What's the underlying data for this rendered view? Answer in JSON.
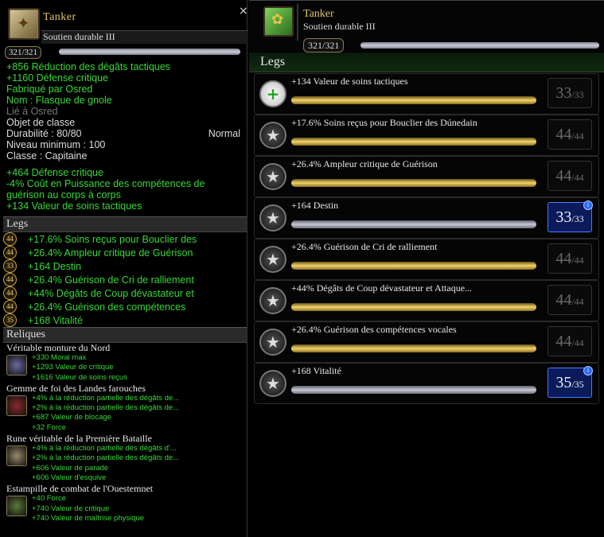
{
  "tooltip": {
    "title": "Tanker",
    "type": "Soutien durable III",
    "close_glyph": "×",
    "xp": "321/321",
    "lines": [
      {
        "text": "+856 Réduction des dégâts tactiques",
        "cls": "g"
      },
      {
        "text": "+1160 Défense critique",
        "cls": "g"
      },
      {
        "text": "Fabriqué par Osred",
        "cls": "g"
      },
      {
        "text": "Nom : Flasque de gnole",
        "cls": "g"
      },
      {
        "text": "Lié à Osred",
        "cls": "d"
      },
      {
        "text": "Objet de classe",
        "cls": "w"
      }
    ],
    "durability_label": "Durabilité : 80/80",
    "durability_quality": "Normal",
    "min_level": "Niveau minimum : 100",
    "class_line": "Classe : Capitaine",
    "extra_lines": [
      "+464 Défense critique",
      "-4% Coût en Puissance des compétences de",
      "guérison au corps à corps",
      "+134 Valeur de soins tactiques"
    ],
    "legs_title": "Legs",
    "legs": [
      {
        "lvl": "44",
        "text": "+17.6% Soins reçus pour Bouclier des"
      },
      {
        "lvl": "44",
        "text": "+26.4% Ampleur critique de Guérison"
      },
      {
        "lvl": "33",
        "text": "+164 Destin"
      },
      {
        "lvl": "44",
        "text": "+26.4% Guérison de Cri de ralliement"
      },
      {
        "lvl": "44",
        "text": "+44% Dégâts de Coup dévastateur et"
      },
      {
        "lvl": "44",
        "text": "+26.4% Guérison des compétences"
      },
      {
        "lvl": "35",
        "text": "+168 Vitalité"
      }
    ],
    "relics_title": "Reliques",
    "relics": [
      {
        "name": "Véritable monture du Nord",
        "icon_color": "#6a6aa0",
        "stats": [
          "+330 Moral max",
          "+1293 Valeur de critique",
          "+1616 Valeur de soins reçus"
        ]
      },
      {
        "name": "Gemme de foi des Landes farouches",
        "icon_color": "#8a2a2a",
        "stats": [
          "+4% à la réduction partielle des dégâts de...",
          "+2% à la réduction partielle des dégâts de...",
          "+687 Valeur de blocage",
          "+32 Force"
        ]
      },
      {
        "name": "Rune véritable de la Première Bataille",
        "icon_color": "#9a8a6a",
        "stats": [
          "+4% à la réduction partielle des dégâts d'...",
          "+2% à la réduction partielle des dégâts de...",
          "+606 Valeur de parade",
          "+606 Valeur d'esquive"
        ]
      },
      {
        "name": "Estampille de combat de l'Ouestemnet",
        "icon_color": "#5a7a3a",
        "stats": [
          "+40 Force",
          "+740 Valeur de critique",
          "+740 Valeur de maîtrise physique"
        ]
      }
    ]
  },
  "panel": {
    "title": "Tanker",
    "type": "Soutien durable III",
    "xp": "321/321",
    "legs_title": "Legs",
    "legs": [
      {
        "text": "+134 Valeur de soins tactiques",
        "lvl": "33",
        "max": "33",
        "icon": "plus",
        "bar": "gold",
        "active": false
      },
      {
        "text": "+17.6% Soins reçus pour Bouclier des Dúnedain",
        "lvl": "44",
        "max": "44",
        "icon": "star",
        "bar": "gold",
        "active": false
      },
      {
        "text": "+26.4% Ampleur critique de Guérison",
        "lvl": "44",
        "max": "44",
        "icon": "star",
        "bar": "gold",
        "active": false
      },
      {
        "text": "+164 Destin",
        "lvl": "33",
        "max": "33",
        "icon": "star",
        "bar": "silver",
        "active": true
      },
      {
        "text": "+26.4% Guérison de Cri de ralliement",
        "lvl": "44",
        "max": "44",
        "icon": "star",
        "bar": "gold",
        "active": false
      },
      {
        "text": "+44% Dégâts de Coup dévastateur et Attaque...",
        "lvl": "44",
        "max": "44",
        "icon": "star",
        "bar": "gold",
        "active": false
      },
      {
        "text": "+26.4% Guérison des compétences vocales",
        "lvl": "44",
        "max": "44",
        "icon": "star",
        "bar": "gold",
        "active": false
      },
      {
        "text": "+168 Vitalité",
        "lvl": "35",
        "max": "35",
        "icon": "star",
        "bar": "silver",
        "active": true
      }
    ]
  }
}
